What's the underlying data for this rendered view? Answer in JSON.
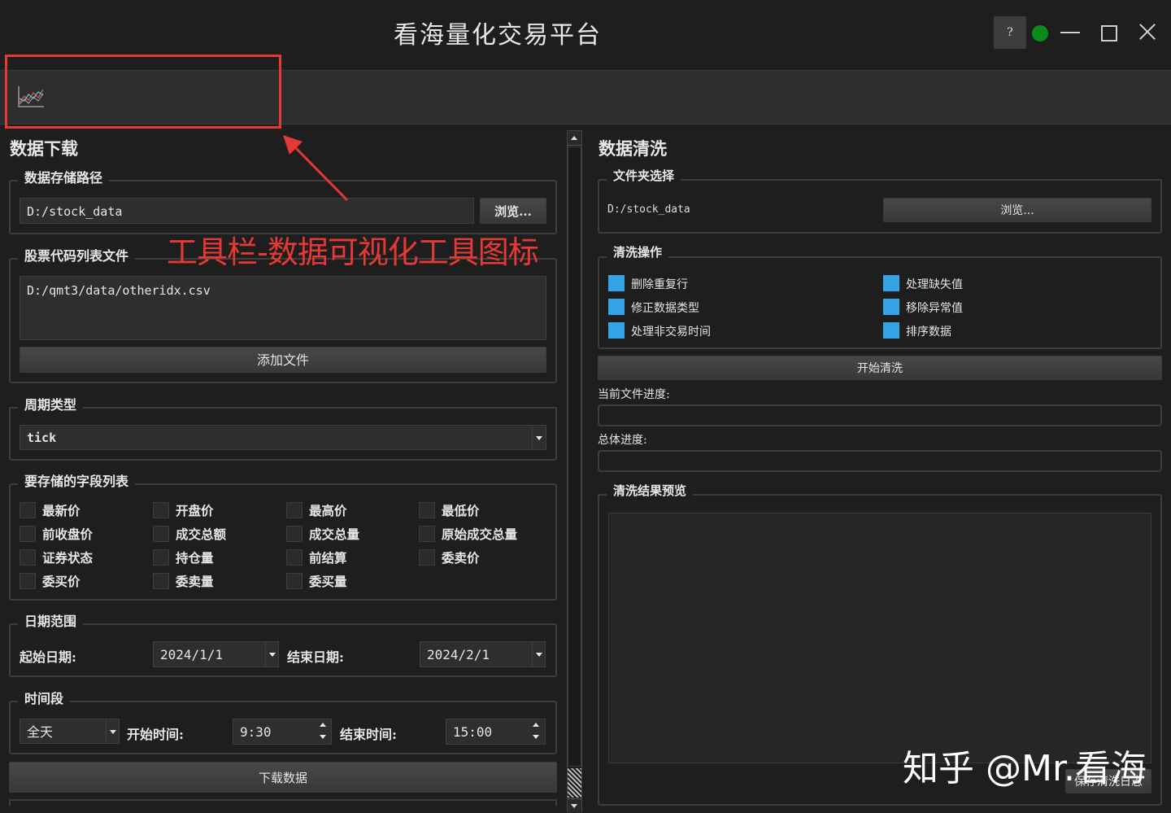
{
  "window": {
    "title": "看海量化交易平台",
    "help_label": "?",
    "status_color": "#0b8a1d"
  },
  "toolbar": {
    "icon": "chart-line-icon"
  },
  "annotation": {
    "text": "工具栏-数据可视化工具图标",
    "color": "#e53935"
  },
  "download": {
    "section_title": "数据下载",
    "storage": {
      "title": "数据存储路径",
      "path": "D:/stock_data",
      "browse_label": "浏览..."
    },
    "stock_list": {
      "title": "股票代码列表文件",
      "file": "D:/qmt3/data/otheridx.csv",
      "add_label": "添加文件"
    },
    "period": {
      "title": "周期类型",
      "value": "tick"
    },
    "fields": {
      "title": "要存储的字段列表",
      "items": [
        {
          "label": "最新价",
          "checked": false
        },
        {
          "label": "开盘价",
          "checked": false
        },
        {
          "label": "最高价",
          "checked": false
        },
        {
          "label": "最低价",
          "checked": false
        },
        {
          "label": "前收盘价",
          "checked": false
        },
        {
          "label": "成交总额",
          "checked": false
        },
        {
          "label": "成交总量",
          "checked": false
        },
        {
          "label": "原始成交总量",
          "checked": false
        },
        {
          "label": "证券状态",
          "checked": false
        },
        {
          "label": "持仓量",
          "checked": false
        },
        {
          "label": "前结算",
          "checked": false
        },
        {
          "label": "委卖价",
          "checked": false
        },
        {
          "label": "委买价",
          "checked": false
        },
        {
          "label": "委卖量",
          "checked": false
        },
        {
          "label": "委买量",
          "checked": false
        }
      ]
    },
    "date_range": {
      "title": "日期范围",
      "start_label": "起始日期:",
      "start": "2024/1/1",
      "end_label": "结束日期:",
      "end": "2024/2/1"
    },
    "time_range": {
      "title": "时间段",
      "mode": "全天",
      "start_label": "开始时间:",
      "start": "9:30",
      "end_label": "结束时间:",
      "end": "15:00"
    },
    "download_label": "下载数据"
  },
  "cleaning": {
    "section_title": "数据清洗",
    "folder": {
      "title": "文件夹选择",
      "path": "D:/stock_data",
      "browse_label": "浏览..."
    },
    "ops": {
      "title": "清洗操作",
      "items": [
        {
          "label": "删除重复行",
          "checked": true
        },
        {
          "label": "处理缺失值",
          "checked": true
        },
        {
          "label": "修正数据类型",
          "checked": true
        },
        {
          "label": "移除异常值",
          "checked": true
        },
        {
          "label": "处理非交易时间",
          "checked": true
        },
        {
          "label": "排序数据",
          "checked": true
        }
      ]
    },
    "start_label": "开始清洗",
    "file_progress_label": "当前文件进度:",
    "total_progress_label": "总体进度:",
    "file_progress": 0,
    "total_progress": 0,
    "preview_title": "清洗结果预览",
    "save_log_label": "保存清洗日志"
  },
  "watermark": "知乎 @Mr.看海"
}
